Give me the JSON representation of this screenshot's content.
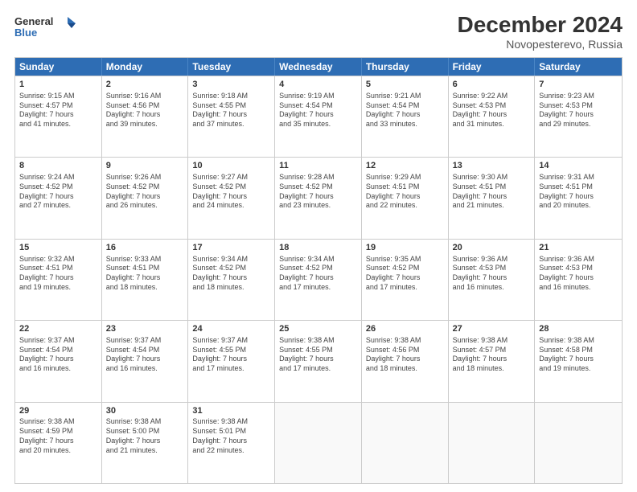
{
  "header": {
    "logo_line1": "General",
    "logo_line2": "Blue",
    "title": "December 2024",
    "location": "Novopesterevo, Russia"
  },
  "days_of_week": [
    "Sunday",
    "Monday",
    "Tuesday",
    "Wednesday",
    "Thursday",
    "Friday",
    "Saturday"
  ],
  "weeks": [
    [
      {
        "day": "1",
        "lines": [
          "Sunrise: 9:15 AM",
          "Sunset: 4:57 PM",
          "Daylight: 7 hours",
          "and 41 minutes."
        ]
      },
      {
        "day": "2",
        "lines": [
          "Sunrise: 9:16 AM",
          "Sunset: 4:56 PM",
          "Daylight: 7 hours",
          "and 39 minutes."
        ]
      },
      {
        "day": "3",
        "lines": [
          "Sunrise: 9:18 AM",
          "Sunset: 4:55 PM",
          "Daylight: 7 hours",
          "and 37 minutes."
        ]
      },
      {
        "day": "4",
        "lines": [
          "Sunrise: 9:19 AM",
          "Sunset: 4:54 PM",
          "Daylight: 7 hours",
          "and 35 minutes."
        ]
      },
      {
        "day": "5",
        "lines": [
          "Sunrise: 9:21 AM",
          "Sunset: 4:54 PM",
          "Daylight: 7 hours",
          "and 33 minutes."
        ]
      },
      {
        "day": "6",
        "lines": [
          "Sunrise: 9:22 AM",
          "Sunset: 4:53 PM",
          "Daylight: 7 hours",
          "and 31 minutes."
        ]
      },
      {
        "day": "7",
        "lines": [
          "Sunrise: 9:23 AM",
          "Sunset: 4:53 PM",
          "Daylight: 7 hours",
          "and 29 minutes."
        ]
      }
    ],
    [
      {
        "day": "8",
        "lines": [
          "Sunrise: 9:24 AM",
          "Sunset: 4:52 PM",
          "Daylight: 7 hours",
          "and 27 minutes."
        ]
      },
      {
        "day": "9",
        "lines": [
          "Sunrise: 9:26 AM",
          "Sunset: 4:52 PM",
          "Daylight: 7 hours",
          "and 26 minutes."
        ]
      },
      {
        "day": "10",
        "lines": [
          "Sunrise: 9:27 AM",
          "Sunset: 4:52 PM",
          "Daylight: 7 hours",
          "and 24 minutes."
        ]
      },
      {
        "day": "11",
        "lines": [
          "Sunrise: 9:28 AM",
          "Sunset: 4:52 PM",
          "Daylight: 7 hours",
          "and 23 minutes."
        ]
      },
      {
        "day": "12",
        "lines": [
          "Sunrise: 9:29 AM",
          "Sunset: 4:51 PM",
          "Daylight: 7 hours",
          "and 22 minutes."
        ]
      },
      {
        "day": "13",
        "lines": [
          "Sunrise: 9:30 AM",
          "Sunset: 4:51 PM",
          "Daylight: 7 hours",
          "and 21 minutes."
        ]
      },
      {
        "day": "14",
        "lines": [
          "Sunrise: 9:31 AM",
          "Sunset: 4:51 PM",
          "Daylight: 7 hours",
          "and 20 minutes."
        ]
      }
    ],
    [
      {
        "day": "15",
        "lines": [
          "Sunrise: 9:32 AM",
          "Sunset: 4:51 PM",
          "Daylight: 7 hours",
          "and 19 minutes."
        ]
      },
      {
        "day": "16",
        "lines": [
          "Sunrise: 9:33 AM",
          "Sunset: 4:51 PM",
          "Daylight: 7 hours",
          "and 18 minutes."
        ]
      },
      {
        "day": "17",
        "lines": [
          "Sunrise: 9:34 AM",
          "Sunset: 4:52 PM",
          "Daylight: 7 hours",
          "and 18 minutes."
        ]
      },
      {
        "day": "18",
        "lines": [
          "Sunrise: 9:34 AM",
          "Sunset: 4:52 PM",
          "Daylight: 7 hours",
          "and 17 minutes."
        ]
      },
      {
        "day": "19",
        "lines": [
          "Sunrise: 9:35 AM",
          "Sunset: 4:52 PM",
          "Daylight: 7 hours",
          "and 17 minutes."
        ]
      },
      {
        "day": "20",
        "lines": [
          "Sunrise: 9:36 AM",
          "Sunset: 4:53 PM",
          "Daylight: 7 hours",
          "and 16 minutes."
        ]
      },
      {
        "day": "21",
        "lines": [
          "Sunrise: 9:36 AM",
          "Sunset: 4:53 PM",
          "Daylight: 7 hours",
          "and 16 minutes."
        ]
      }
    ],
    [
      {
        "day": "22",
        "lines": [
          "Sunrise: 9:37 AM",
          "Sunset: 4:54 PM",
          "Daylight: 7 hours",
          "and 16 minutes."
        ]
      },
      {
        "day": "23",
        "lines": [
          "Sunrise: 9:37 AM",
          "Sunset: 4:54 PM",
          "Daylight: 7 hours",
          "and 16 minutes."
        ]
      },
      {
        "day": "24",
        "lines": [
          "Sunrise: 9:37 AM",
          "Sunset: 4:55 PM",
          "Daylight: 7 hours",
          "and 17 minutes."
        ]
      },
      {
        "day": "25",
        "lines": [
          "Sunrise: 9:38 AM",
          "Sunset: 4:55 PM",
          "Daylight: 7 hours",
          "and 17 minutes."
        ]
      },
      {
        "day": "26",
        "lines": [
          "Sunrise: 9:38 AM",
          "Sunset: 4:56 PM",
          "Daylight: 7 hours",
          "and 18 minutes."
        ]
      },
      {
        "day": "27",
        "lines": [
          "Sunrise: 9:38 AM",
          "Sunset: 4:57 PM",
          "Daylight: 7 hours",
          "and 18 minutes."
        ]
      },
      {
        "day": "28",
        "lines": [
          "Sunrise: 9:38 AM",
          "Sunset: 4:58 PM",
          "Daylight: 7 hours",
          "and 19 minutes."
        ]
      }
    ],
    [
      {
        "day": "29",
        "lines": [
          "Sunrise: 9:38 AM",
          "Sunset: 4:59 PM",
          "Daylight: 7 hours",
          "and 20 minutes."
        ]
      },
      {
        "day": "30",
        "lines": [
          "Sunrise: 9:38 AM",
          "Sunset: 5:00 PM",
          "Daylight: 7 hours",
          "and 21 minutes."
        ]
      },
      {
        "day": "31",
        "lines": [
          "Sunrise: 9:38 AM",
          "Sunset: 5:01 PM",
          "Daylight: 7 hours",
          "and 22 minutes."
        ]
      },
      {
        "day": "",
        "lines": []
      },
      {
        "day": "",
        "lines": []
      },
      {
        "day": "",
        "lines": []
      },
      {
        "day": "",
        "lines": []
      }
    ]
  ]
}
